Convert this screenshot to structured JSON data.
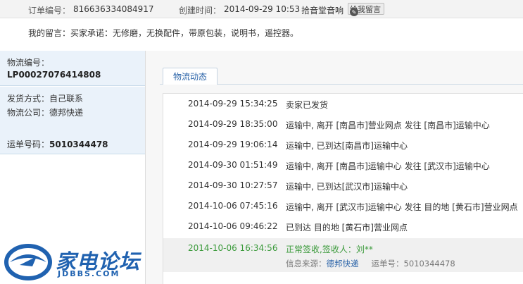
{
  "order": {
    "number_label": "订单编号：",
    "number": "816636334084917",
    "created_label": "创建时间：",
    "created": "2014-09-29 10:53",
    "seller": "拾音堂音响",
    "message_button": "给我留言"
  },
  "note": {
    "text": "我的留言：买家承诺：无修磨，无换配件，带原包装，说明书，遥控器。"
  },
  "logistics": {
    "id_label": "物流编号：",
    "id": "LP00027076414808",
    "ship_method": "发货方式：自己联系",
    "company": "物流公司：德邦快递",
    "waybill_label": "运单号码：",
    "waybill": "5010344478"
  },
  "tracking": {
    "tab_label": "物流动态",
    "events": [
      {
        "date": "2014-09-29 15:34:25",
        "msg": "卖家已发货"
      },
      {
        "date": "2014-09-29 18:35:00",
        "msg": "运输中, 离开 [南昌市]营业网点 发往 [南昌市]运输中心"
      },
      {
        "date": "2014-09-29 19:06:14",
        "msg": "运输中, 已到达[南昌市]运输中心"
      },
      {
        "date": "2014-09-30 01:51:49",
        "msg": "运输中, 离开 [南昌市]运输中心 发往 [武汉市]运输中心"
      },
      {
        "date": "2014-09-30 10:27:57",
        "msg": "运输中, 已到达[武汉市]运输中心"
      },
      {
        "date": "2014-10-06 07:45:16",
        "msg": "运输中, 离开 [武汉市]运输中心 发往 目的地 [黄石市]营业网点"
      },
      {
        "date": "2014-10-06 09:46:22",
        "msg": "已到达 目的地 [黄石市]营业网点"
      }
    ],
    "latest": {
      "date": "2014-10-06 16:34:56",
      "msg": "正常签收,签收人：刘**",
      "source_label": "信息来源：",
      "source": "德邦快递",
      "waybill_label": "运单号：",
      "waybill": "5010344478"
    }
  },
  "watermark": {
    "brand": "家电论坛",
    "domain": "JDBBS.COM"
  },
  "colors": {
    "accent_blue": "#2a63a8",
    "latest_green": "#3b9a3b",
    "panel_blue": "#eaf2fa"
  }
}
